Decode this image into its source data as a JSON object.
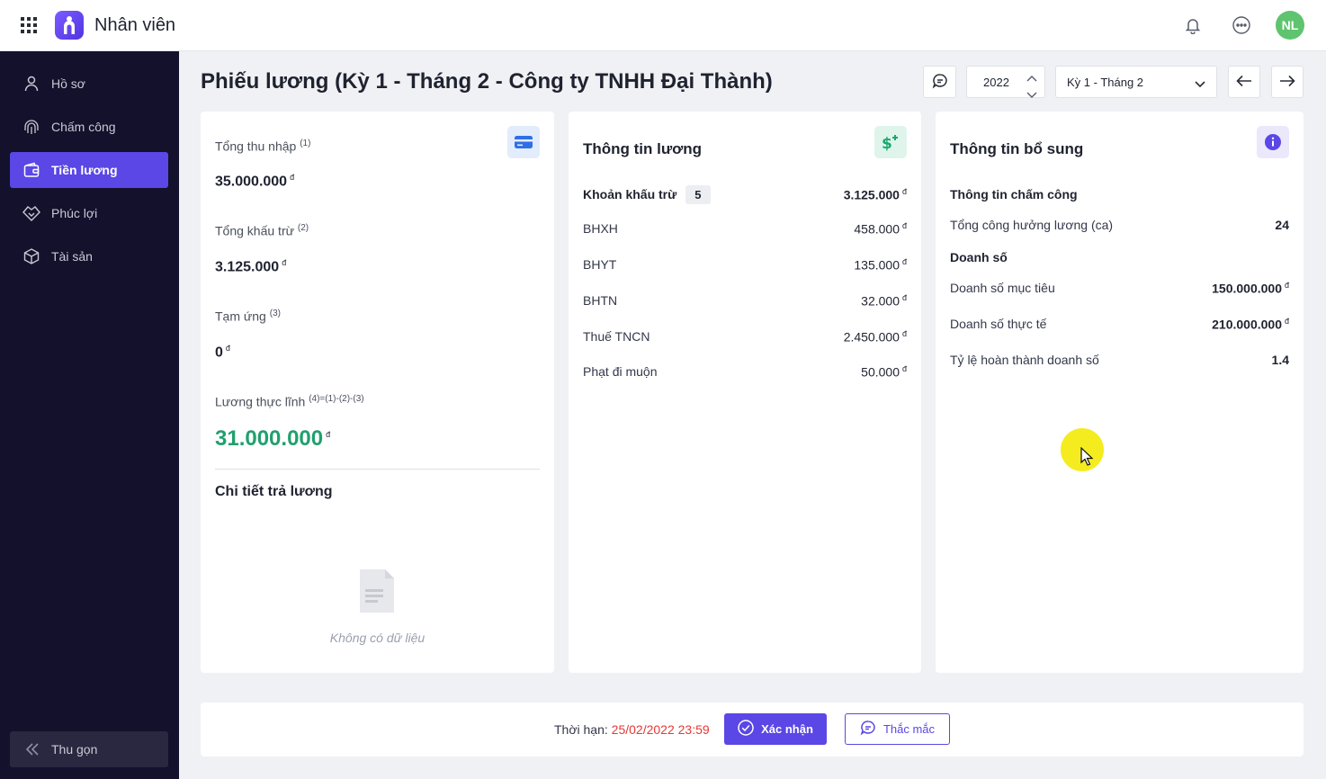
{
  "app": {
    "title": "Nhân viên",
    "avatar_initials": "NL"
  },
  "sidebar": {
    "items": [
      {
        "label": "Hồ sơ",
        "icon": "user-icon"
      },
      {
        "label": "Chấm công",
        "icon": "fingerprint-icon"
      },
      {
        "label": "Tiền lương",
        "icon": "wallet-icon",
        "active": true
      },
      {
        "label": "Phúc lợi",
        "icon": "handshake-icon"
      },
      {
        "label": "Tài sản",
        "icon": "box-icon"
      }
    ],
    "collapse_label": "Thu gọn"
  },
  "header": {
    "title": "Phiếu lương (Kỳ 1 - Tháng 2 - Công ty TNHH Đại Thành)",
    "year": "2022",
    "period": "Kỳ 1 - Tháng 2"
  },
  "summary": {
    "total_income_label": "Tổng thu nhập",
    "total_income_note": "(1)",
    "total_income": "35.000.000",
    "total_deduction_label": "Tổng khấu trừ",
    "total_deduction_note": "(2)",
    "total_deduction": "3.125.000",
    "advance_label": "Tạm ứng",
    "advance_note": "(3)",
    "advance": "0",
    "net_label": "Lương thực lĩnh",
    "net_note": "(4)=(1)-(2)-(3)",
    "net": "31.000.000",
    "currency": "đ",
    "payment_detail_title": "Chi tiết trả lương",
    "empty_text": "Không có dữ liệu"
  },
  "salary_info": {
    "title": "Thông tin lương",
    "deductions_label": "Khoản khấu trừ",
    "deductions_count": "5",
    "deductions_total": "3.125.000",
    "items": [
      {
        "label": "BHXH",
        "value": "458.000"
      },
      {
        "label": "BHYT",
        "value": "135.000"
      },
      {
        "label": "BHTN",
        "value": "32.000"
      },
      {
        "label": "Thuế TNCN",
        "value": "2.450.000"
      },
      {
        "label": "Phạt đi muộn",
        "value": "50.000"
      }
    ]
  },
  "extra_info": {
    "title": "Thông tin bổ sung",
    "attendance_heading": "Thông tin chấm công",
    "paid_shifts_label": "Tổng công hưởng lương (ca)",
    "paid_shifts": "24",
    "sales_heading": "Doanh số",
    "target_label": "Doanh số mục tiêu",
    "target": "150.000.000",
    "actual_label": "Doanh số thực tế",
    "actual": "210.000.000",
    "completion_label": "Tỷ lệ hoàn thành doanh số",
    "completion": "1.4"
  },
  "footer": {
    "deadline_label": "Thời hạn:",
    "deadline": "25/02/2022 23:59",
    "confirm_label": "Xác nhận",
    "question_label": "Thắc mắc"
  },
  "colors": {
    "accent": "#5a47e5",
    "sidebar": "#13112c",
    "net": "#21a06e",
    "deadline": "#e53935"
  }
}
